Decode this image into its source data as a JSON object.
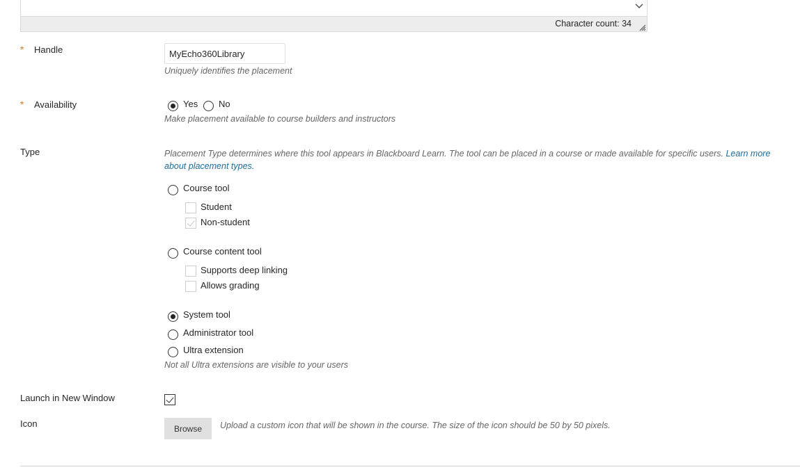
{
  "editor": {
    "character_count_label": "Character count: 34",
    "scroll_icon": "chevron-down-icon",
    "resize_icon": "resize-grip-icon"
  },
  "handle": {
    "required_marker": "*",
    "label": "Handle",
    "value": "MyEcho360Library",
    "hint": "Uniquely identifies the placement"
  },
  "availability": {
    "required_marker": "*",
    "label": "Availability",
    "options": [
      {
        "label": "Yes",
        "selected": true
      },
      {
        "label": "No",
        "selected": false
      }
    ],
    "hint": "Make placement available to course builders and instructors"
  },
  "type": {
    "label": "Type",
    "hint": "Placement Type determines where this tool appears in Blackboard Learn. The tool can be placed in a course or made available for specific users.",
    "learn_more_link": "Learn more about placement types.",
    "options": [
      {
        "label": "Course tool",
        "selected": false,
        "sub_options": [
          {
            "label": "Student",
            "checked": false
          },
          {
            "label": "Non-student",
            "checked": true,
            "disabled": true
          }
        ]
      },
      {
        "label": "Course content tool",
        "selected": false,
        "sub_options": [
          {
            "label": "Supports deep linking",
            "checked": false
          },
          {
            "label": "Allows grading",
            "checked": false
          }
        ]
      },
      {
        "label": "System tool",
        "selected": true
      },
      {
        "label": "Administrator tool",
        "selected": false
      },
      {
        "label": "Ultra extension",
        "selected": false
      }
    ],
    "ultra_hint": "Not all Ultra extensions are visible to your users"
  },
  "launch_new_window": {
    "label": "Launch in New Window",
    "checked": true
  },
  "icon": {
    "label": "Icon",
    "browse_label": "Browse",
    "hint": "Upload a custom icon that will be shown in the course. The size of the icon should be 50 by 50 pixels."
  },
  "colors": {
    "required": "#e67e22",
    "link": "#1b6d9a",
    "hint_text": "#666666"
  }
}
